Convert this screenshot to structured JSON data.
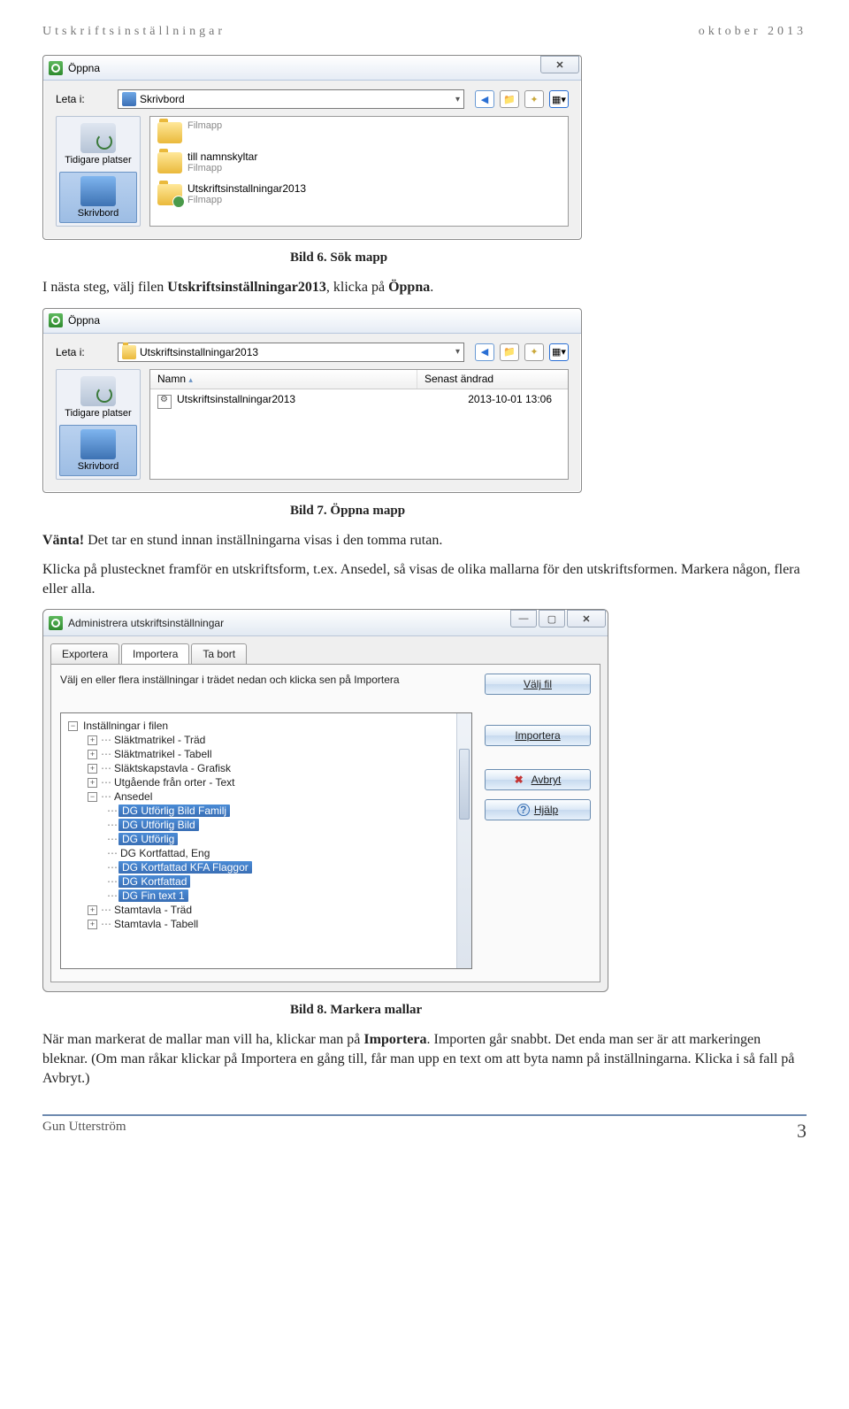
{
  "doc_header": {
    "left": "Utskriftsinställningar",
    "right": "oktober 2013"
  },
  "dialog1": {
    "title": "Öppna",
    "lookin_label": "Leta i:",
    "lookin_value": "Skrivbord",
    "places": {
      "0": {
        "label": "Tidigare platser"
      },
      "1": {
        "label": "Skrivbord"
      }
    },
    "files": {
      "0": {
        "name": "Filmapp",
        "sub": ""
      },
      "1": {
        "name": "till namnskyltar",
        "sub": "Filmapp"
      },
      "2": {
        "name": "Utskriftsinstallningar2013",
        "sub": "Filmapp"
      }
    }
  },
  "caption1": "Bild 6. Sök mapp",
  "para1_a": "I nästa steg, välj filen ",
  "para1_b": "Utskriftsinställningar2013",
  "para1_c": ", klicka på ",
  "para1_d": "Öppna",
  "para1_e": ".",
  "dialog2": {
    "title": "Öppna",
    "lookin_label": "Leta i:",
    "lookin_value": "Utskriftsinstallningar2013",
    "cols": {
      "name": "Namn",
      "modified": "Senast ändrad"
    },
    "places": {
      "0": {
        "label": "Tidigare platser"
      },
      "1": {
        "label": "Skrivbord"
      }
    },
    "file": {
      "name": "Utskriftsinstallningar2013",
      "date": "2013-10-01 13:06"
    }
  },
  "caption2": "Bild 7. Öppna mapp",
  "para2_a": "Vänta!",
  "para2_b": " Det tar en stund innan inställningarna visas i den tomma rutan.",
  "para3": "Klicka på plustecknet framför en utskriftsform, t.ex. Ansedel, så visas de olika mallarna för den utskriftsformen. Markera någon, flera eller alla.",
  "admin": {
    "title": "Administrera utskriftsinställningar",
    "tabs": {
      "0": "Exportera",
      "1": "Importera",
      "2": "Ta bort"
    },
    "instruction": "Välj en eller flera inställningar i trädet nedan och klicka sen på Importera",
    "buttons": {
      "select": "Välj fil",
      "import": "Importera",
      "cancel": "Avbryt",
      "help": "Hjälp"
    },
    "tree": {
      "root": "Inställningar i filen",
      "n": {
        "0": "Släktmatrikel - Träd",
        "1": "Släktmatrikel - Tabell",
        "2": "Släktskapstavla - Grafisk",
        "3": "Utgående från orter - Text",
        "4": "Ansedel",
        "5": "Stamtavla - Träd",
        "6": "Stamtavla - Tabell"
      },
      "leaf": {
        "0": "DG Utförlig Bild Familj",
        "1": "DG Utförlig Bild",
        "2": "DG Utförlig",
        "3": "DG Kortfattad, Eng",
        "4": "DG Kortfattad KFA Flaggor",
        "5": "DG Kortfattad",
        "6": "DG Fin text 1"
      }
    }
  },
  "caption3": "Bild 8. Markera mallar",
  "para4_a": "När man markerat de mallar man vill ha, klickar man på ",
  "para4_b": "Importera",
  "para4_c": ". Importen går snabbt. Det enda man ser är att markeringen bleknar. (Om man råkar klickar på Importera en gång till, får man upp en text om att byta namn på inställningarna. Klicka i så fall på Avbryt.)",
  "footer": {
    "author": "Gun Utterström",
    "page": "3"
  }
}
